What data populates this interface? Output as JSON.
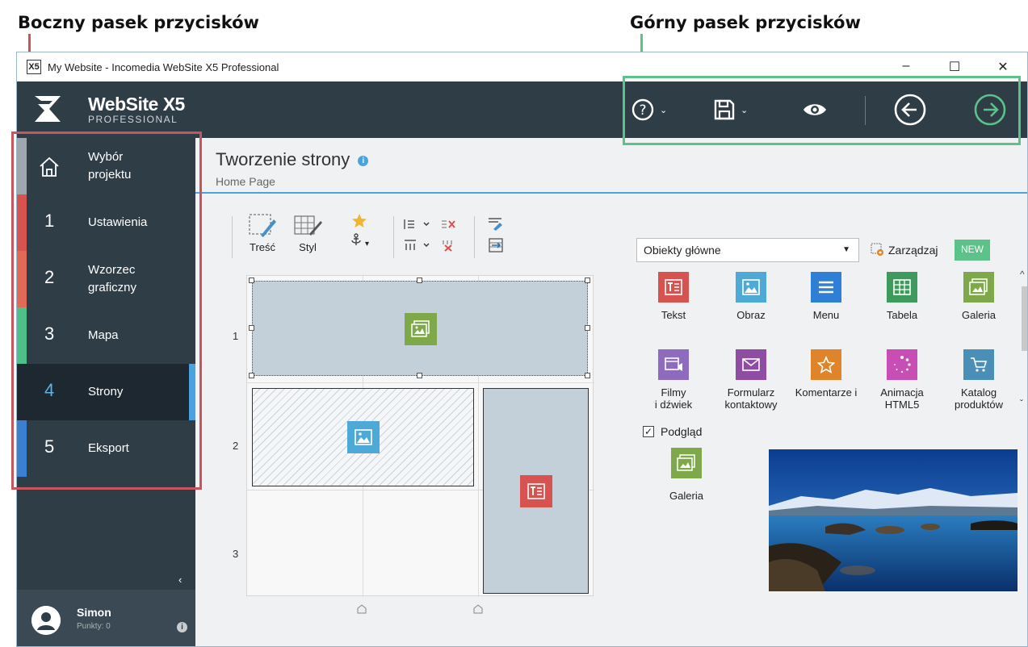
{
  "annotations": {
    "left_title": "Boczny pasek przycisków",
    "right_title": "Górny pasek przycisków"
  },
  "window": {
    "title": "My Website - Incomedia WebSite X5 Professional",
    "icon_letter": "X5",
    "controls": {
      "minimize": "–",
      "maximize": "☐",
      "close": "✕"
    }
  },
  "brand": {
    "name": "WebSite X5",
    "edition": "PROFESSIONAL"
  },
  "toolbar": {
    "icons": [
      "help-icon",
      "save-icon",
      "preview-eye-icon",
      "back-arrow-icon",
      "next-arrow-icon"
    ],
    "chevron": "⌄",
    "accent_color": "#5dc18a"
  },
  "sidebar": {
    "items": [
      {
        "num": "",
        "label": "Wybór projektu",
        "color": "#9ea7ad"
      },
      {
        "num": "1",
        "label": "Ustawienia",
        "color": "#d6534f"
      },
      {
        "num": "2",
        "label": "Wzorzec graficzny",
        "color": "#e06a55"
      },
      {
        "num": "3",
        "label": "Mapa",
        "color": "#4fbf8a"
      },
      {
        "num": "4",
        "label": "Strony",
        "color": "#1d2830",
        "active": true
      },
      {
        "num": "5",
        "label": "Eksport",
        "color": "#3b7fd0"
      }
    ],
    "collapse_symbol": "‹",
    "user": {
      "name": "Simon",
      "points": "Punkty: 0",
      "info": "i"
    }
  },
  "page": {
    "title": "Tworzenie strony",
    "info": "i",
    "subtitle": "Home Page"
  },
  "tools": {
    "content_label": "Treść",
    "style_label": "Styl",
    "anchor_dropdown": "▾"
  },
  "grid": {
    "rows": [
      "1",
      "2",
      "3"
    ]
  },
  "objects": {
    "category": "Obiekty główne",
    "manage_label": "Zarządzaj",
    "new_badge": "NEW",
    "items": [
      {
        "label": "Tekst",
        "color": "#d6534f",
        "icon": "text-icon"
      },
      {
        "label": "Obraz",
        "color": "#4ea9d6",
        "icon": "image-icon"
      },
      {
        "label": "Menu",
        "color": "#2f7fd6",
        "icon": "menu-icon"
      },
      {
        "label": "Tabela",
        "color": "#3f9a5e",
        "icon": "table-icon"
      },
      {
        "label": "Galeria",
        "color": "#7ea84a",
        "icon": "gallery-icon"
      },
      {
        "label": "Filmy\ni dźwiek",
        "color": "#8e6bbf",
        "icon": "video-icon"
      },
      {
        "label": "Formularz\nkontaktowy",
        "color": "#8e4ca2",
        "icon": "form-icon"
      },
      {
        "label": "Komentarze i",
        "color": "#e0842a",
        "icon": "star-icon"
      },
      {
        "label": "Animacja\nHTML5",
        "color": "#c84db5",
        "icon": "animation-icon"
      },
      {
        "label": "Katalog\nproduktów",
        "color": "#4a8fb7",
        "icon": "catalog-icon"
      }
    ],
    "scroll": {
      "up": "^",
      "down": "ˇ"
    }
  },
  "preview": {
    "checkbox_label": "Podgląd",
    "check": "✓",
    "item_label": "Galeria"
  }
}
